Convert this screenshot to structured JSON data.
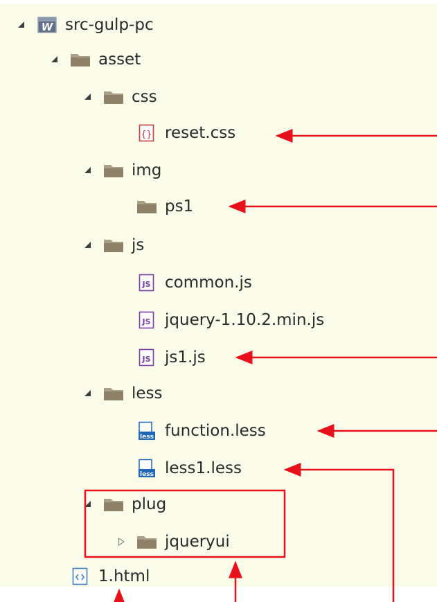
{
  "tree": {
    "project": "src-gulp-pc",
    "asset": "asset",
    "css_folder": "css",
    "css_file": "reset.css",
    "img_folder": "img",
    "img_sub": "ps1",
    "js_folder": "js",
    "js_file1": "common.js",
    "js_file2": "jquery-1.10.2.min.js",
    "js_file3": "js1.js",
    "less_folder": "less",
    "less_file1": "function.less",
    "less_file2": "less1.less",
    "plug_folder": "plug",
    "plug_sub": "jqueryui",
    "html_file": "1.html"
  },
  "icon_text": {
    "project_badge": "W",
    "js_badge": "JS",
    "less_badge": "less"
  },
  "colors": {
    "background": "#fbfbe9",
    "annotation_red": "#e8101a",
    "folder": "#8c8066",
    "js_icon": "#7a3fa6",
    "less_icon": "#1e67b8",
    "css_icon": "#c43e3e",
    "html_icon": "#3f7fbf"
  },
  "icons": {
    "expanded": "triangle-expanded-icon",
    "collapsed": "triangle-collapsed-icon",
    "folder": "folder-icon",
    "project": "web-project-icon",
    "css": "css-file-icon",
    "js": "js-file-icon",
    "less": "less-file-icon",
    "html": "html-file-icon"
  }
}
